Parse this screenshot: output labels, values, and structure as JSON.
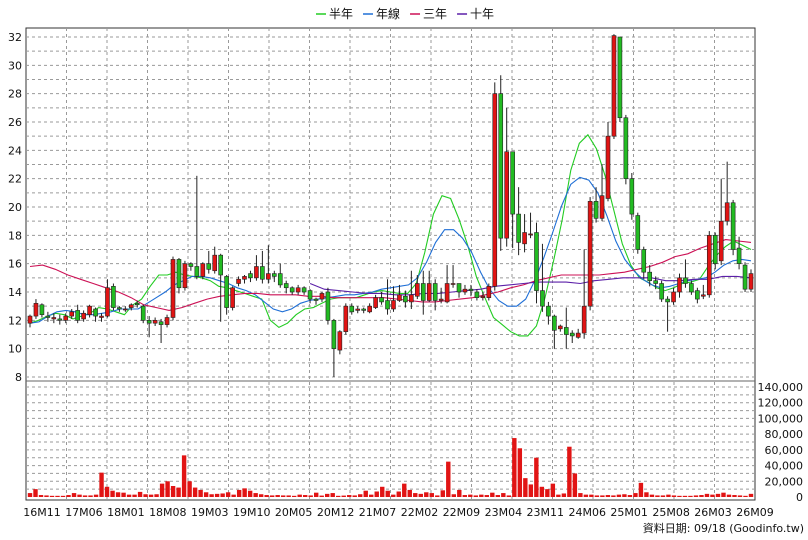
{
  "legend": {
    "items": [
      {
        "label": "半年",
        "color": "#22cc22"
      },
      {
        "label": "年線",
        "color": "#1f6fd6"
      },
      {
        "label": "三年",
        "color": "#cc1155"
      },
      {
        "label": "十年",
        "color": "#5b1fa8"
      }
    ]
  },
  "footer": {
    "text": "資料日期: 09/18 (Goodinfo.tw)"
  },
  "colors": {
    "up": "#e11414",
    "down": "#22bb22",
    "volume": "#e11414",
    "grid": "#9a9a9a"
  },
  "chart_data": {
    "type": "candlestick",
    "price_axis": {
      "min": 8,
      "max": 32,
      "ticks": [
        "8",
        "10",
        "12",
        "14",
        "16",
        "18",
        "20",
        "22",
        "24",
        "26",
        "28",
        "30",
        "32"
      ]
    },
    "volume_axis": {
      "min": 0,
      "max": 140000,
      "ticks": [
        "0",
        "20,000",
        "40,000",
        "60,000",
        "80,000",
        "100,000",
        "120,000",
        "140,000"
      ]
    },
    "x_labels": [
      "16M11",
      "17M06",
      "18M01",
      "18M08",
      "19M03",
      "19M10",
      "20M05",
      "20M12",
      "21M07",
      "22M02",
      "22M09",
      "23M04",
      "23M11",
      "24M06",
      "25M01",
      "25M08",
      "26M03",
      "26M09"
    ],
    "candles": [
      [
        11.8,
        12.3,
        11.5,
        12.4
      ],
      [
        12.3,
        13.2,
        12.1,
        13.5
      ],
      [
        13.1,
        12.4,
        12.2,
        13.2
      ],
      [
        12.3,
        12.2,
        11.9,
        12.6
      ],
      [
        12.1,
        12.2,
        11.8,
        12.5
      ],
      [
        12.1,
        12.0,
        11.7,
        12.4
      ],
      [
        12.0,
        12.3,
        11.8,
        12.5
      ],
      [
        12.3,
        12.6,
        12.1,
        12.8
      ],
      [
        12.7,
        12.0,
        11.8,
        13.1
      ],
      [
        12.1,
        12.5,
        11.9,
        12.7
      ],
      [
        12.4,
        13.0,
        12.2,
        13.1
      ],
      [
        12.8,
        12.3,
        11.9,
        12.9
      ],
      [
        12.2,
        12.3,
        11.9,
        12.5
      ],
      [
        12.3,
        14.3,
        12.2,
        14.9
      ],
      [
        14.4,
        12.9,
        12.7,
        14.6
      ],
      [
        12.9,
        12.8,
        12.6,
        13.0
      ],
      [
        12.8,
        12.8,
        12.6,
        13.0
      ],
      [
        12.9,
        13.1,
        12.7,
        13.2
      ],
      [
        13.2,
        13.1,
        12.9,
        13.4
      ],
      [
        13.0,
        12.0,
        11.8,
        13.1
      ],
      [
        12.0,
        11.8,
        10.8,
        12.3
      ],
      [
        11.8,
        12.0,
        11.6,
        12.2
      ],
      [
        11.9,
        11.7,
        10.4,
        12.1
      ],
      [
        11.7,
        12.2,
        11.5,
        12.4
      ],
      [
        12.2,
        16.3,
        12.0,
        16.5
      ],
      [
        16.3,
        14.3,
        13.9,
        16.4
      ],
      [
        14.3,
        16.0,
        14.1,
        16.2
      ],
      [
        16.0,
        15.8,
        15.5,
        16.1
      ],
      [
        15.8,
        15.1,
        14.9,
        22.2
      ],
      [
        15.1,
        16.0,
        14.9,
        16.1
      ],
      [
        16.0,
        15.6,
        15.3,
        16.9
      ],
      [
        15.5,
        16.6,
        15.3,
        17.2
      ],
      [
        16.6,
        15.2,
        11.9,
        16.7
      ],
      [
        15.1,
        12.9,
        12.4,
        15.2
      ],
      [
        12.9,
        14.3,
        12.7,
        14.4
      ],
      [
        14.6,
        14.9,
        14.4,
        15.1
      ],
      [
        14.9,
        15.1,
        14.6,
        15.2
      ],
      [
        15.3,
        15.0,
        14.7,
        15.5
      ],
      [
        15.0,
        15.8,
        14.8,
        16.6
      ],
      [
        15.8,
        14.9,
        14.6,
        16.9
      ],
      [
        14.9,
        15.3,
        14.6,
        17.3
      ],
      [
        15.3,
        15.1,
        14.7,
        15.5
      ],
      [
        15.3,
        14.5,
        14.3,
        16.0
      ],
      [
        14.6,
        14.3,
        13.9,
        14.8
      ],
      [
        14.3,
        14.0,
        13.8,
        14.4
      ],
      [
        14.0,
        14.3,
        13.8,
        14.5
      ],
      [
        14.3,
        14.0,
        13.8,
        14.4
      ],
      [
        14.1,
        13.5,
        13.2,
        14.2
      ],
      [
        13.5,
        13.4,
        13.1,
        13.6
      ],
      [
        13.5,
        13.9,
        13.3,
        14.0
      ],
      [
        14.0,
        12.0,
        11.7,
        14.3
      ],
      [
        12.0,
        10.0,
        8.0,
        12.1
      ],
      [
        9.9,
        11.2,
        9.6,
        11.3
      ],
      [
        11.2,
        13.0,
        11.0,
        13.2
      ],
      [
        13.0,
        12.6,
        12.4,
        13.2
      ],
      [
        12.7,
        12.8,
        12.5,
        13.0
      ],
      [
        12.8,
        12.7,
        12.5,
        12.9
      ],
      [
        12.6,
        13.0,
        12.5,
        13.2
      ],
      [
        12.9,
        13.6,
        12.8,
        13.8
      ],
      [
        13.6,
        13.3,
        13.1,
        14.0
      ],
      [
        13.4,
        12.8,
        12.4,
        14.9
      ],
      [
        12.8,
        13.4,
        12.6,
        14.4
      ],
      [
        13.4,
        13.8,
        13.3,
        14.5
      ],
      [
        13.7,
        13.3,
        12.9,
        14.1
      ],
      [
        13.3,
        13.8,
        12.8,
        15.5
      ],
      [
        13.7,
        14.6,
        13.5,
        15.2
      ],
      [
        14.6,
        13.4,
        12.4,
        15.5
      ],
      [
        13.4,
        14.6,
        13.3,
        15.5
      ],
      [
        14.6,
        13.4,
        12.7,
        14.9
      ],
      [
        13.4,
        13.5,
        13.2,
        14.3
      ],
      [
        13.3,
        14.6,
        13.2,
        15.9
      ],
      [
        14.6,
        14.6,
        14.3,
        15.9
      ],
      [
        14.6,
        14.0,
        13.6,
        14.6
      ],
      [
        14.0,
        14.2,
        13.8,
        14.5
      ],
      [
        14.2,
        14.1,
        13.7,
        14.5
      ],
      [
        14.0,
        13.6,
        13.4,
        14.2
      ],
      [
        13.6,
        13.7,
        13.4,
        14.0
      ],
      [
        13.6,
        14.4,
        13.4,
        14.6
      ],
      [
        14.4,
        28.0,
        14.1,
        28.8
      ],
      [
        28.0,
        17.8,
        16.9,
        29.3
      ],
      [
        17.8,
        23.9,
        17.2,
        27.0
      ],
      [
        23.9,
        19.5,
        17.1,
        23.8
      ],
      [
        19.5,
        17.5,
        16.6,
        21.4
      ],
      [
        17.4,
        18.2,
        16.8,
        19.5
      ],
      [
        18.1,
        18.1,
        17.8,
        19.6
      ],
      [
        18.2,
        14.1,
        13.2,
        18.9
      ],
      [
        14.1,
        13.0,
        12.6,
        17.4
      ],
      [
        13.0,
        12.3,
        11.7,
        13.3
      ],
      [
        12.3,
        11.3,
        10.0,
        12.4
      ],
      [
        11.4,
        11.6,
        11.2,
        11.7
      ],
      [
        11.5,
        11.0,
        10.0,
        12.9
      ],
      [
        11.1,
        10.9,
        10.4,
        11.3
      ],
      [
        10.8,
        11.1,
        10.7,
        11.4
      ],
      [
        11.1,
        13.0,
        10.7,
        17.0
      ],
      [
        13.0,
        20.4,
        12.7,
        20.7
      ],
      [
        20.4,
        19.2,
        18.9,
        21.4
      ],
      [
        19.2,
        20.8,
        19.0,
        23.0
      ],
      [
        20.6,
        25.0,
        20.4,
        26.0
      ],
      [
        25.0,
        32.1,
        24.8,
        32.2
      ],
      [
        32.0,
        26.3,
        26.0,
        31.8
      ],
      [
        26.3,
        22.0,
        21.6,
        26.5
      ],
      [
        22.0,
        19.5,
        19.1,
        22.4
      ],
      [
        19.4,
        17.0,
        16.7,
        19.6
      ],
      [
        17.0,
        15.4,
        14.9,
        17.2
      ],
      [
        15.4,
        14.8,
        14.4,
        15.9
      ],
      [
        14.8,
        14.6,
        14.2,
        15.1
      ],
      [
        14.6,
        13.5,
        13.3,
        14.8
      ],
      [
        13.5,
        13.3,
        11.2,
        13.7
      ],
      [
        13.3,
        14.0,
        13.1,
        14.3
      ],
      [
        14.0,
        15.0,
        13.6,
        15.3
      ],
      [
        15.0,
        14.6,
        14.3,
        16.3
      ],
      [
        14.6,
        14.0,
        13.8,
        14.8
      ],
      [
        14.1,
        13.5,
        13.2,
        14.3
      ],
      [
        13.7,
        13.8,
        13.5,
        14.5
      ],
      [
        13.8,
        18.0,
        13.6,
        18.3
      ],
      [
        18.0,
        16.0,
        15.6,
        18.2
      ],
      [
        16.2,
        19.0,
        15.9,
        22.0
      ],
      [
        19.0,
        20.3,
        18.7,
        23.2
      ],
      [
        20.3,
        17.0,
        16.6,
        20.5
      ],
      [
        17.1,
        16.0,
        15.6,
        17.9
      ],
      [
        15.9,
        14.2,
        14.0,
        16.1
      ],
      [
        14.2,
        15.3,
        14.0,
        15.6
      ]
    ],
    "ma": {
      "半年": [
        11.8,
        12.0,
        12.3,
        12.5,
        12.4,
        12.1,
        12.3,
        12.5,
        12.9,
        12.8,
        12.6,
        12.4,
        13.1,
        13.5,
        14.4,
        15.2,
        15.2,
        15.4,
        15.2,
        15.1,
        15.0,
        14.8,
        14.4,
        14.3,
        14.1,
        13.9,
        13.7,
        13.5,
        12.0,
        11.5,
        11.8,
        12.4,
        12.8,
        12.9,
        13.2,
        13.5,
        13.6,
        13.6,
        13.6,
        13.8,
        14.0,
        14.1,
        14.0,
        13.9,
        13.9,
        14.6,
        16.8,
        19.5,
        20.8,
        20.6,
        19.1,
        17.3,
        15.1,
        13.6,
        12.2,
        11.7,
        11.2,
        10.9,
        10.9,
        11.6,
        13.6,
        16.2,
        19.1,
        22.6,
        24.5,
        25.1,
        24.1,
        22.2,
        19.8,
        17.4,
        15.9,
        15.0,
        14.7,
        14.3,
        14.1,
        14.3,
        14.6,
        14.7,
        14.9,
        15.8,
        16.6,
        17.2,
        17.6,
        17.3,
        17.0
      ],
      "年線": [
        11.8,
        11.9,
        12.3,
        12.6,
        12.7,
        12.6,
        12.4,
        12.4,
        12.5,
        12.6,
        12.8,
        12.8,
        12.8,
        13.2,
        13.6,
        14.0,
        14.5,
        14.8,
        15.1,
        15.1,
        15.0,
        14.8,
        14.6,
        14.3,
        14.1,
        13.8,
        13.3,
        12.8,
        12.6,
        12.8,
        13.2,
        13.4,
        13.5,
        13.6,
        13.7,
        13.8,
        13.8,
        13.9,
        14.0,
        14.2,
        14.3,
        14.4,
        14.5,
        15.0,
        16.1,
        17.5,
        18.4,
        18.4,
        17.8,
        16.8,
        15.4,
        14.2,
        13.4,
        13.0,
        13.0,
        13.5,
        14.8,
        16.4,
        18.2,
        20.1,
        21.6,
        22.1,
        21.9,
        21.0,
        19.4,
        17.6,
        16.3,
        15.5,
        14.9,
        14.5,
        14.3,
        14.4,
        14.6,
        14.8,
        14.9,
        15.0,
        15.4,
        15.9,
        16.2,
        16.3,
        16.2
      ],
      "三年": [
        15.8,
        15.9,
        15.6,
        15.2,
        14.9,
        14.6,
        14.3,
        14.0,
        13.6,
        13.1,
        12.9,
        12.7,
        12.9,
        13.2,
        13.5,
        13.7,
        13.8,
        13.9,
        13.9,
        13.8,
        13.8,
        13.8,
        13.7,
        13.7,
        13.6,
        13.6,
        13.6,
        13.6,
        13.6,
        13.5,
        13.4,
        13.3,
        13.3,
        13.4,
        13.5,
        13.6,
        13.8,
        14.0,
        14.3,
        14.5,
        14.8,
        15.0,
        15.2,
        15.2,
        15.2,
        15.2,
        15.3,
        15.4,
        15.6,
        15.8,
        16.1,
        16.5,
        16.7,
        17.1,
        17.4,
        17.7,
        17.6,
        17.5
      ],
      "十年": [
        14.6,
        14.2,
        14.1,
        14.0,
        13.9,
        13.9,
        13.8,
        13.8,
        13.9,
        13.9,
        14.0,
        14.1,
        14.2,
        14.4,
        14.5,
        14.6,
        14.7,
        14.7,
        14.7,
        14.6,
        14.8,
        14.9,
        15.0,
        15.0,
        15.0,
        14.8,
        14.8,
        14.9,
        14.9,
        15.1,
        15.1,
        15.0
      ]
    },
    "ma_start": {
      "半年": 0,
      "年線": 0,
      "三年": 0,
      "十年": 47
    },
    "volumes": [
      5000,
      10000,
      2500,
      2000,
      1500,
      1500,
      1500,
      2500,
      5000,
      3000,
      2000,
      2000,
      3000,
      31000,
      13000,
      8000,
      6000,
      5500,
      3000,
      3000,
      6500,
      3500,
      3000,
      3500,
      17000,
      20000,
      14000,
      12000,
      53000,
      20000,
      12000,
      9000,
      6000,
      3500,
      4000,
      4500,
      6000,
      3000,
      9000,
      11000,
      8000,
      5000,
      3500,
      2500,
      2000,
      2500,
      2000,
      2000,
      1500,
      3000,
      2500,
      2000,
      5500,
      1800,
      4000,
      5000,
      1500,
      1800,
      2500,
      2000,
      3500,
      8000,
      3000,
      7000,
      13000,
      8000,
      3000,
      7000,
      17000,
      9000,
      5000,
      4000,
      6000,
      5000,
      2000,
      8500,
      45000,
      3500,
      9000,
      2500,
      3000,
      2000,
      3000,
      2500,
      5500,
      2500,
      5000,
      2000,
      75000,
      62000,
      24000,
      16000,
      50000,
      13000,
      10000,
      17000,
      3000,
      4500,
      64000,
      30000,
      5000,
      3000,
      3000,
      2000,
      2000,
      2500,
      2000,
      3000,
      3500,
      2500,
      5000,
      18000,
      6000,
      3000,
      2000,
      2000,
      3000,
      2000,
      1500,
      1500,
      1500,
      2000,
      2500,
      4000,
      3000,
      4000,
      5500,
      3000,
      2500,
      2000,
      1500,
      4000
    ]
  }
}
